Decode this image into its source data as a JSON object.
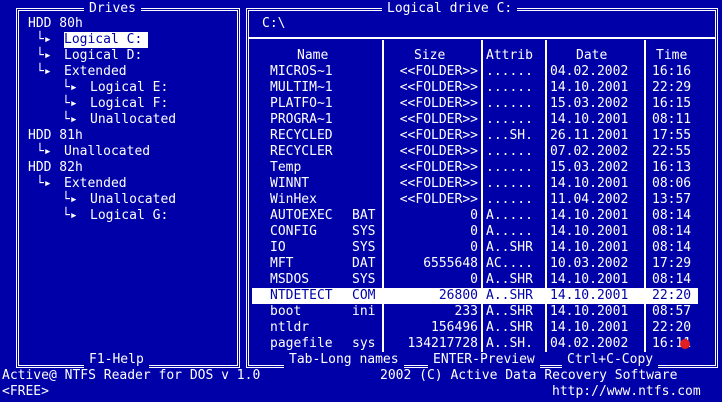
{
  "drives_panel": {
    "title": "Drives",
    "tree": [
      {
        "label": "HDD 80h",
        "indent": 0,
        "prefix": "",
        "selected": false
      },
      {
        "label": "Logical C:",
        "indent": 1,
        "prefix": "└▸ ",
        "selected": true
      },
      {
        "label": "Logical D:",
        "indent": 1,
        "prefix": "└▸ ",
        "selected": false
      },
      {
        "label": "Extended",
        "indent": 1,
        "prefix": "└▸ ",
        "selected": false
      },
      {
        "label": "Logical E:",
        "indent": 2,
        "prefix": "└▸ ",
        "selected": false
      },
      {
        "label": "Logical F:",
        "indent": 2,
        "prefix": "└▸ ",
        "selected": false
      },
      {
        "label": "Unallocated",
        "indent": 2,
        "prefix": "└▸ ",
        "selected": false
      },
      {
        "label": "HDD 81h",
        "indent": 0,
        "prefix": "",
        "selected": false
      },
      {
        "label": "Unallocated",
        "indent": 1,
        "prefix": "└▸ ",
        "selected": false
      },
      {
        "label": "HDD 82h",
        "indent": 0,
        "prefix": "",
        "selected": false
      },
      {
        "label": "Extended",
        "indent": 1,
        "prefix": "└▸ ",
        "selected": false
      },
      {
        "label": "Unallocated",
        "indent": 2,
        "prefix": "└▸ ",
        "selected": false
      },
      {
        "label": "Logical G:",
        "indent": 2,
        "prefix": "└▸ ",
        "selected": false
      }
    ],
    "help": "F1-Help"
  },
  "files_panel": {
    "title": "Logical drive C:",
    "path": "C:\\",
    "columns": {
      "name": "Name",
      "size": "Size",
      "attrib": "Attrib",
      "date": "Date",
      "time": "Time"
    },
    "rows": [
      {
        "name": "MICROS~1",
        "ext": "",
        "size": "<<FOLDER>>",
        "attrib": "......",
        "date": "04.02.2002",
        "time": "16:16"
      },
      {
        "name": "MULTIM~1",
        "ext": "",
        "size": "<<FOLDER>>",
        "attrib": "......",
        "date": "14.10.2001",
        "time": "22:29"
      },
      {
        "name": "PLATFO~1",
        "ext": "",
        "size": "<<FOLDER>>",
        "attrib": "......",
        "date": "15.03.2002",
        "time": "16:15"
      },
      {
        "name": "PROGRA~1",
        "ext": "",
        "size": "<<FOLDER>>",
        "attrib": "......",
        "date": "14.10.2001",
        "time": "08:11"
      },
      {
        "name": "RECYCLED",
        "ext": "",
        "size": "<<FOLDER>>",
        "attrib": "...SH.",
        "date": "26.11.2001",
        "time": "17:55"
      },
      {
        "name": "RECYCLER",
        "ext": "",
        "size": "<<FOLDER>>",
        "attrib": "......",
        "date": "07.02.2002",
        "time": "22:55"
      },
      {
        "name": "Temp",
        "ext": "",
        "size": "<<FOLDER>>",
        "attrib": "......",
        "date": "15.03.2002",
        "time": "16:13"
      },
      {
        "name": "WINNT",
        "ext": "",
        "size": "<<FOLDER>>",
        "attrib": "......",
        "date": "14.10.2001",
        "time": "08:06"
      },
      {
        "name": "WinHex",
        "ext": "",
        "size": "<<FOLDER>>",
        "attrib": "......",
        "date": "11.04.2002",
        "time": "13:57"
      },
      {
        "name": "AUTOEXEC",
        "ext": "BAT",
        "size": "0",
        "attrib": "A.....",
        "date": "14.10.2001",
        "time": "08:14"
      },
      {
        "name": "CONFIG",
        "ext": "SYS",
        "size": "0",
        "attrib": "A.....",
        "date": "14.10.2001",
        "time": "08:14"
      },
      {
        "name": "IO",
        "ext": "SYS",
        "size": "0",
        "attrib": "A..SHR",
        "date": "14.10.2001",
        "time": "08:14"
      },
      {
        "name": "MFT",
        "ext": "DAT",
        "size": "6555648",
        "attrib": "AC....",
        "date": "10.03.2002",
        "time": "17:29"
      },
      {
        "name": "MSDOS",
        "ext": "SYS",
        "size": "0",
        "attrib": "A..SHR",
        "date": "14.10.2001",
        "time": "08:14"
      },
      {
        "name": "NTDETECT",
        "ext": "COM",
        "size": "26800",
        "attrib": "A..SHR",
        "date": "14.10.2001",
        "time": "22:20",
        "selected": true
      },
      {
        "name": "boot",
        "ext": "ini",
        "size": "233",
        "attrib": "A..SHR",
        "date": "14.10.2001",
        "time": "08:57"
      },
      {
        "name": "ntldr",
        "ext": "",
        "size": "156496",
        "attrib": "A..SHR",
        "date": "14.10.2001",
        "time": "22:20"
      },
      {
        "name": "pagefile",
        "ext": "sys",
        "size": "134217728",
        "attrib": "A..SH.",
        "date": "04.02.2002",
        "time": "16:11"
      }
    ],
    "hints": {
      "tab": "Tab-Long names",
      "enter": "ENTER-Preview",
      "copy": "Ctrl+C-Copy"
    }
  },
  "status_bar": {
    "product": "Active@ NTFS Reader for DOS v 1.0",
    "copyright": "2002 (C) Active Data Recovery Software",
    "free": "<FREE>",
    "url": "http://www.ntfs.com"
  },
  "colors": {
    "background": "#0000a8",
    "foreground": "#ffffff"
  }
}
